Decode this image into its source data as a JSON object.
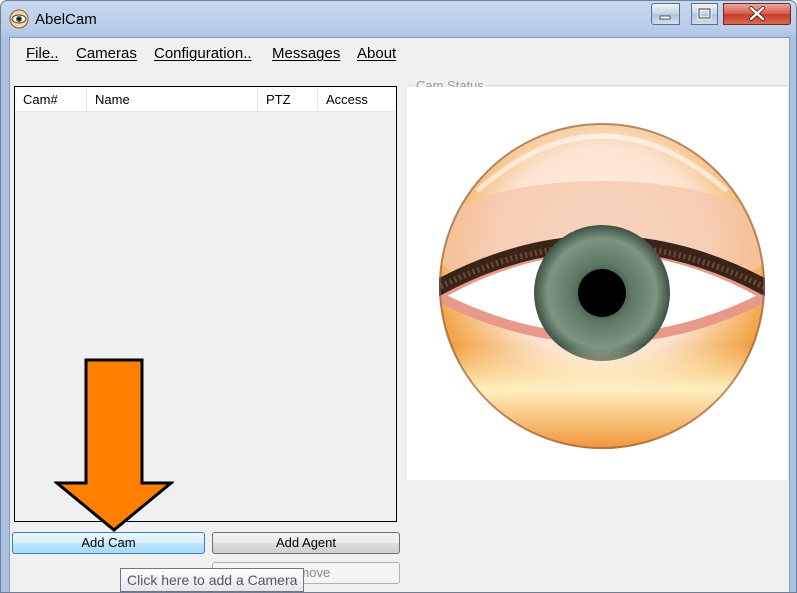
{
  "window": {
    "title": "AbelCam"
  },
  "menu": [
    {
      "label": "File.."
    },
    {
      "label": "Cameras"
    },
    {
      "label": "Configuration.."
    },
    {
      "label": "Messages"
    },
    {
      "label": "About"
    }
  ],
  "camera_list": {
    "columns": [
      "Cam#",
      "Name",
      "PTZ",
      "Access"
    ]
  },
  "cam_status": {
    "label": "Cam Status"
  },
  "buttons": {
    "add_cam": "Add Cam",
    "add_agent": "Add Agent",
    "remove": "Remove"
  },
  "tooltip": {
    "text": "Click here to add a Camera"
  },
  "colors": {
    "arrow": "#ff8000",
    "title_close": "#c43b2c"
  }
}
